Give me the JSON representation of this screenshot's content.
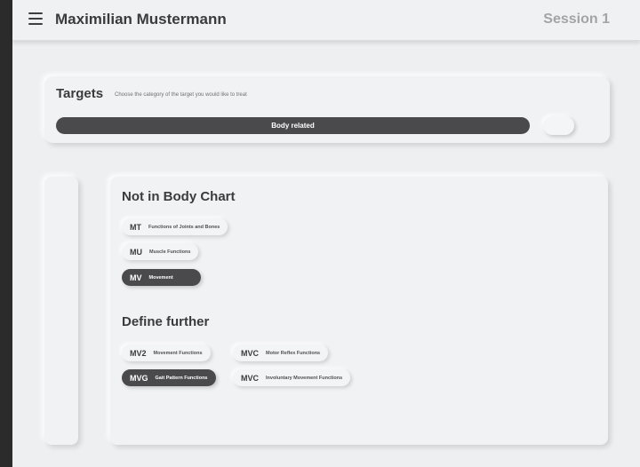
{
  "header": {
    "user_name": "Maximilian Mustermann",
    "session": "Session 1"
  },
  "targets": {
    "title": "Targets",
    "subtitle": "Choose the category of the target you would like to treat",
    "selected_category": "Body related"
  },
  "not_in_body_chart": {
    "title": "Not in Body Chart",
    "chips": [
      {
        "code": "MT",
        "label": "Functions of Joints and Bones",
        "selected": false
      },
      {
        "code": "MU",
        "label": "Muscle Functions",
        "selected": false
      },
      {
        "code": "MV",
        "label": "Movement",
        "selected": true
      }
    ]
  },
  "define_further": {
    "title": "Define further",
    "chips": [
      {
        "code": "MV2",
        "label": "Movement Functions",
        "selected": false
      },
      {
        "code": "MVC",
        "label": "Motor Reflex Functions",
        "selected": false
      },
      {
        "code": "MVG",
        "label": "Gait Pattern Functions",
        "selected": true
      },
      {
        "code": "MVC",
        "label": "Involuntary Movement Functions",
        "selected": false
      }
    ]
  }
}
